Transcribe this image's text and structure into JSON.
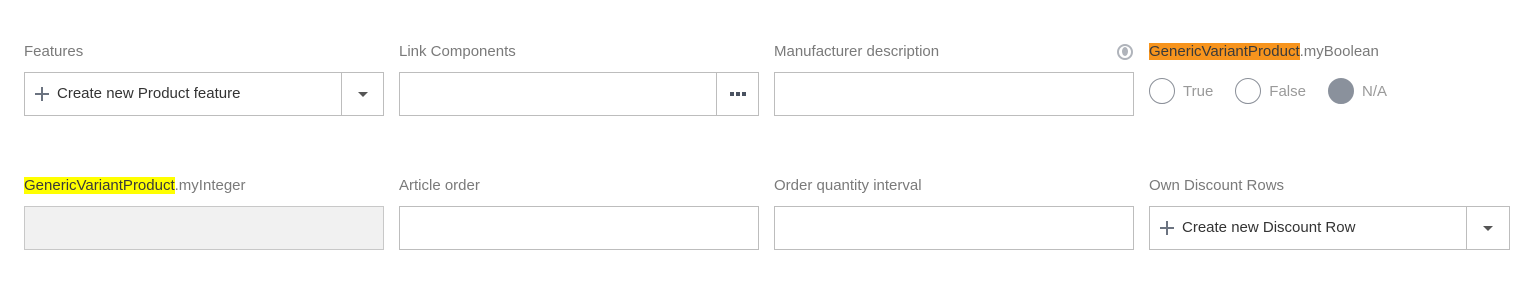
{
  "row1": {
    "features": {
      "label": "Features",
      "button_label": "Create new Product feature",
      "plus_icon": "plus-icon",
      "caret_icon": "chevron-down-icon"
    },
    "link_components": {
      "label": "Link Components",
      "value": "",
      "dots_icon": "ellipsis-icon"
    },
    "manufacturer_description": {
      "label": "Manufacturer description",
      "value": "",
      "globe_icon": "globe-icon"
    },
    "my_boolean": {
      "label_highlight": "GenericVariantProduct",
      "label_rest": ".myBoolean",
      "highlight_color": "#f7941d",
      "options": [
        {
          "label": "True",
          "checked": false
        },
        {
          "label": "False",
          "checked": false
        },
        {
          "label": "N/A",
          "checked": true
        }
      ]
    }
  },
  "row2": {
    "my_integer": {
      "label_highlight": "GenericVariantProduct",
      "label_rest": ".myInteger",
      "highlight_color": "#ffff00",
      "value": ""
    },
    "article_order": {
      "label": "Article order",
      "value": ""
    },
    "order_quantity_interval": {
      "label": "Order quantity interval",
      "value": ""
    },
    "own_discount_rows": {
      "label": "Own Discount Rows",
      "button_label": "Create new Discount Row",
      "plus_icon": "plus-icon",
      "caret_icon": "chevron-down-icon"
    }
  }
}
